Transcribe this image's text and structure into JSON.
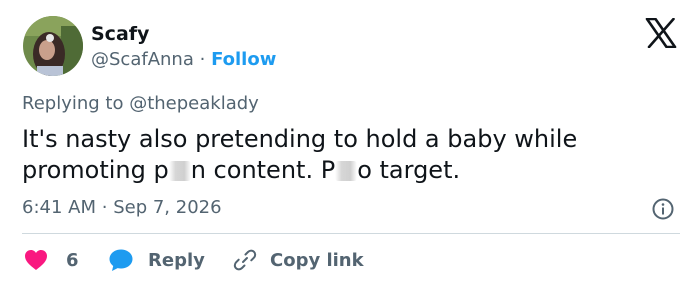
{
  "author": {
    "name": "Scafy",
    "handle": "@ScafAnna",
    "separator": "·",
    "follow_label": "Follow"
  },
  "reply": {
    "prefix": "Replying to",
    "to": "@thepeaklady"
  },
  "tweet": {
    "line1": "It's nasty also pretending to hold a baby while",
    "line2_part1": "promoting p",
    "line2_part2": "n content. P",
    "line2_part3": "o target."
  },
  "meta": {
    "time": "6:41 AM",
    "separator": "·",
    "date": "Sep 7, 2026"
  },
  "actions": {
    "like_count": "6",
    "reply_label": "Reply",
    "copy_label": "Copy link"
  },
  "colors": {
    "accent": "#1d9bf0",
    "like": "#f91880",
    "muted": "#536471",
    "text": "#0f1419"
  },
  "icons": {
    "x_logo": "x-logo-icon",
    "info": "info-icon",
    "heart": "heart-icon",
    "reply": "reply-bubble-icon",
    "link": "link-icon"
  }
}
